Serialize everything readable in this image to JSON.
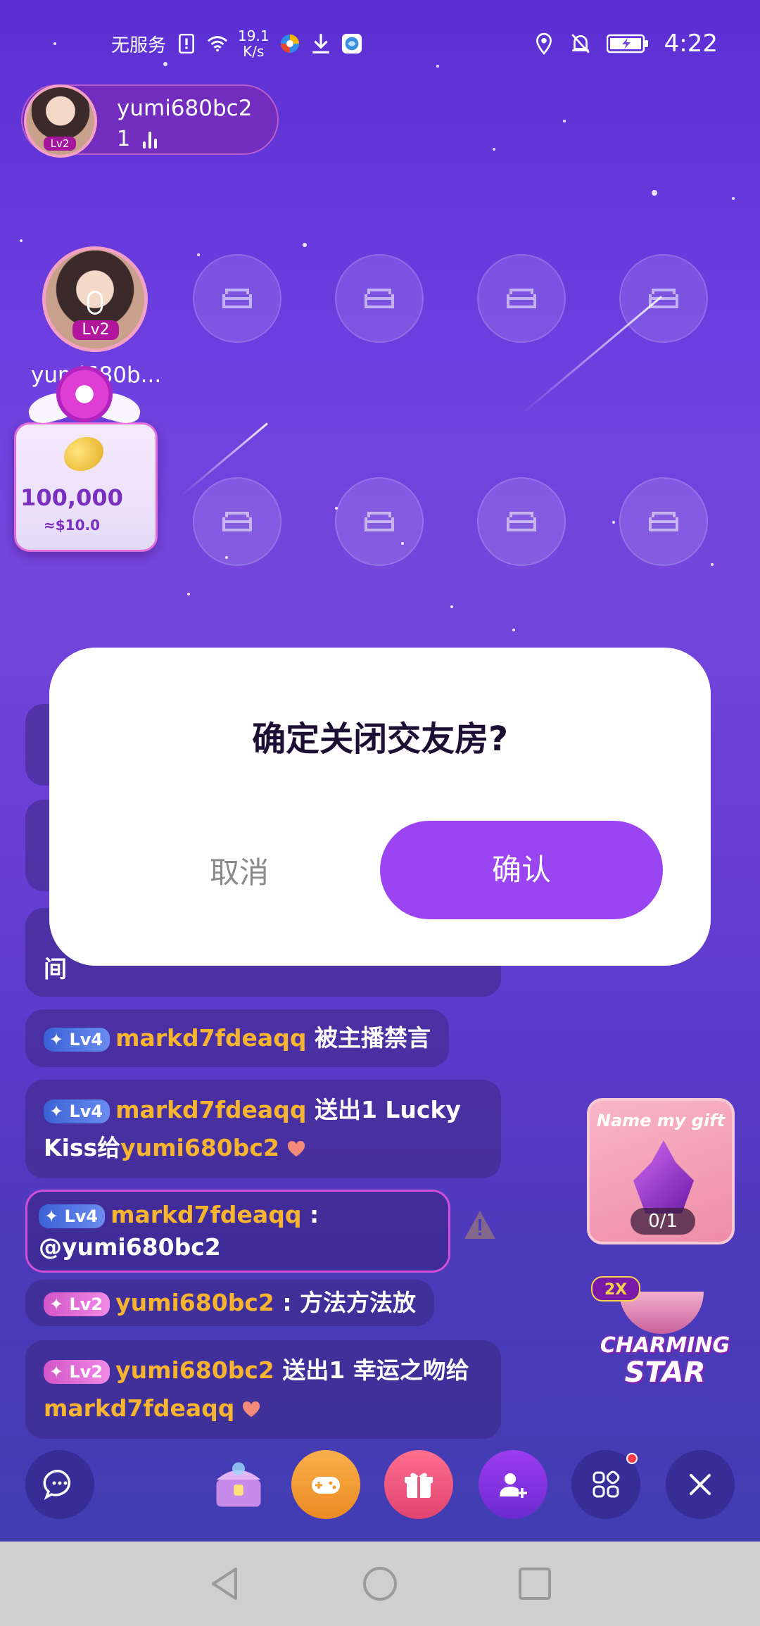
{
  "status_bar": {
    "carrier": "无服务",
    "speed_value": "19.1",
    "speed_unit": "K/s",
    "time": "4:22"
  },
  "host": {
    "name": "yumi680bc2",
    "listener_count": "1",
    "level": "Lv2"
  },
  "mic_seat": {
    "name": "yumi680b...",
    "level": "Lv2"
  },
  "gift_card": {
    "amount": "100,000",
    "usd": "≈$10.0"
  },
  "chat": [
    {
      "level": "Lv4",
      "user": "markd7fdeaqq",
      "text": "被主播禁言"
    },
    {
      "level": "Lv4",
      "user": "markd7fdeaqq",
      "text_pre": "送出1 Lucky Kiss给",
      "target": "yumi680bc2"
    },
    {
      "level": "Lv4",
      "user": "markd7fdeaqq",
      "text_pre": " :",
      "mention": "@yumi680bc2"
    },
    {
      "level": "Lv2",
      "user": "yumi680bc2",
      "text": " : 方法方法放"
    },
    {
      "level": "Lv2",
      "user": "yumi680bc2",
      "text_pre": "送出1 幸运之吻给",
      "target": "markd7fdeaqq"
    }
  ],
  "partial_chat_tail": "间",
  "promos": {
    "name_gift_title": "Name my gift",
    "name_gift_count": "0/1",
    "charm_badge": "2X",
    "charm_text_1": "CHARMING",
    "charm_text_2": "STAR"
  },
  "dialog": {
    "title": "确定关闭交友房?",
    "cancel": "取消",
    "confirm": "确认"
  },
  "colors": {
    "accent": "#9b45f2",
    "username": "#f6b430",
    "background_top": "#5b2fd3"
  }
}
